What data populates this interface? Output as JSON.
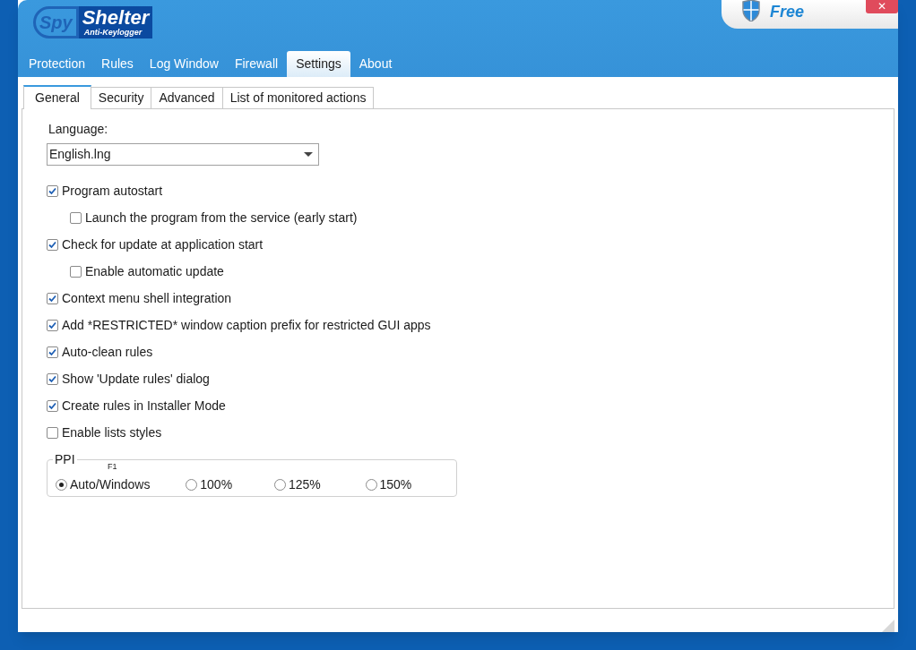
{
  "logo": {
    "prefix": "Spy",
    "name": "Shelter",
    "tagline": "Anti-Keylogger"
  },
  "edition": {
    "label": "Free"
  },
  "close_button": {
    "label": "✕"
  },
  "main_tabs": [
    {
      "label": "Protection",
      "selected": false
    },
    {
      "label": "Rules",
      "selected": false
    },
    {
      "label": "Log Window",
      "selected": false
    },
    {
      "label": "Firewall",
      "selected": false
    },
    {
      "label": "Settings",
      "selected": true
    },
    {
      "label": "About",
      "selected": false
    }
  ],
  "sub_tabs": [
    {
      "label": "General",
      "selected": true
    },
    {
      "label": "Security",
      "selected": false
    },
    {
      "label": "Advanced",
      "selected": false
    },
    {
      "label": "List of monitored actions",
      "selected": false
    }
  ],
  "language": {
    "label": "Language:",
    "value": "English.lng"
  },
  "options": [
    {
      "label": "Program autostart",
      "checked": true,
      "children": [
        {
          "label": "Launch the program from the service (early start)",
          "checked": false
        }
      ]
    },
    {
      "label": "Check for update at application start",
      "checked": true,
      "children": [
        {
          "label": "Enable automatic update",
          "checked": false
        }
      ]
    },
    {
      "label": "Context menu shell integration",
      "checked": true
    },
    {
      "label": "Add *RESTRICTED* window caption prefix for restricted GUI apps",
      "checked": true
    },
    {
      "label": "Auto-clean rules",
      "checked": true
    },
    {
      "label": "Show 'Update rules' dialog",
      "checked": true
    },
    {
      "label": "Create rules in Installer Mode",
      "checked": true
    },
    {
      "label": "Enable lists styles",
      "checked": false
    }
  ],
  "ppi": {
    "title": "PPI",
    "hint": "F1",
    "choices": [
      {
        "label": "Auto/Windows",
        "selected": true
      },
      {
        "label": "100%",
        "selected": false
      },
      {
        "label": "125%",
        "selected": false
      },
      {
        "label": "150%",
        "selected": false
      }
    ]
  }
}
